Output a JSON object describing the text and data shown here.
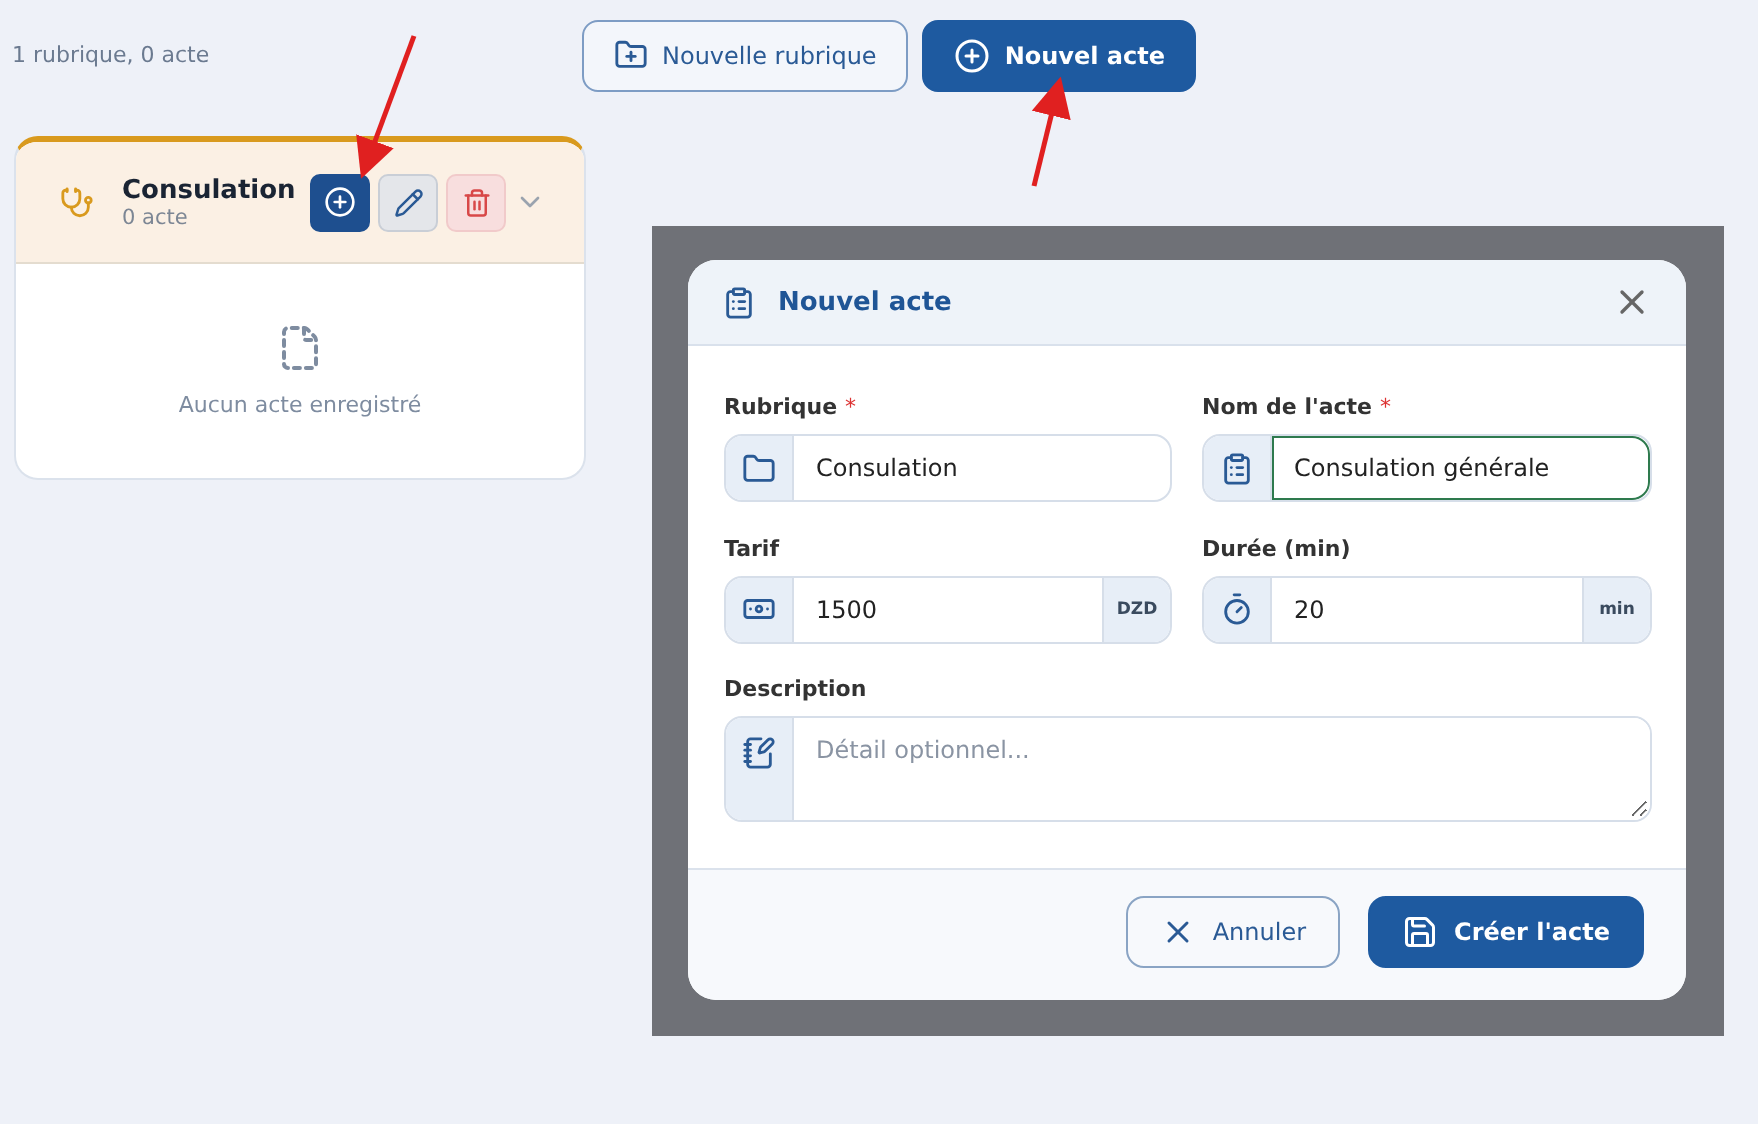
{
  "summary": "1 rubrique, 0 acte",
  "toolbar": [
    {
      "label": "Nouvelle rubrique",
      "kind": "outline"
    },
    {
      "label": "Nouvel acte",
      "kind": "primary"
    }
  ],
  "rubrics": [
    {
      "name": "Consulation",
      "count": "0 acte",
      "expanded": true,
      "color": "#d99a1e",
      "empty_text": "Aucun acte enregistré"
    }
  ],
  "dialog": {
    "title": "Nouvel acte",
    "fields": [
      {
        "label": "Rubrique",
        "required_mark": "*",
        "kind": "text",
        "value": "Consulation",
        "focused": false
      },
      {
        "label": "Nom de l'acte",
        "required_mark": "*",
        "kind": "text",
        "value": "Consulation générale",
        "focused": true
      },
      {
        "label": "Tarif",
        "kind": "text",
        "value": "1500",
        "suffix": "DZD",
        "focused": false
      },
      {
        "label": "Durée (min)",
        "kind": "text",
        "value": "20",
        "suffix": "min",
        "focused": false
      },
      {
        "label": "Description",
        "kind": "textarea",
        "placeholder": "Détail optionnel...",
        "focused": false
      }
    ],
    "buttons": [
      {
        "label": "Annuler",
        "kind": "outline"
      },
      {
        "label": "Créer l'acte",
        "kind": "primary"
      }
    ]
  }
}
